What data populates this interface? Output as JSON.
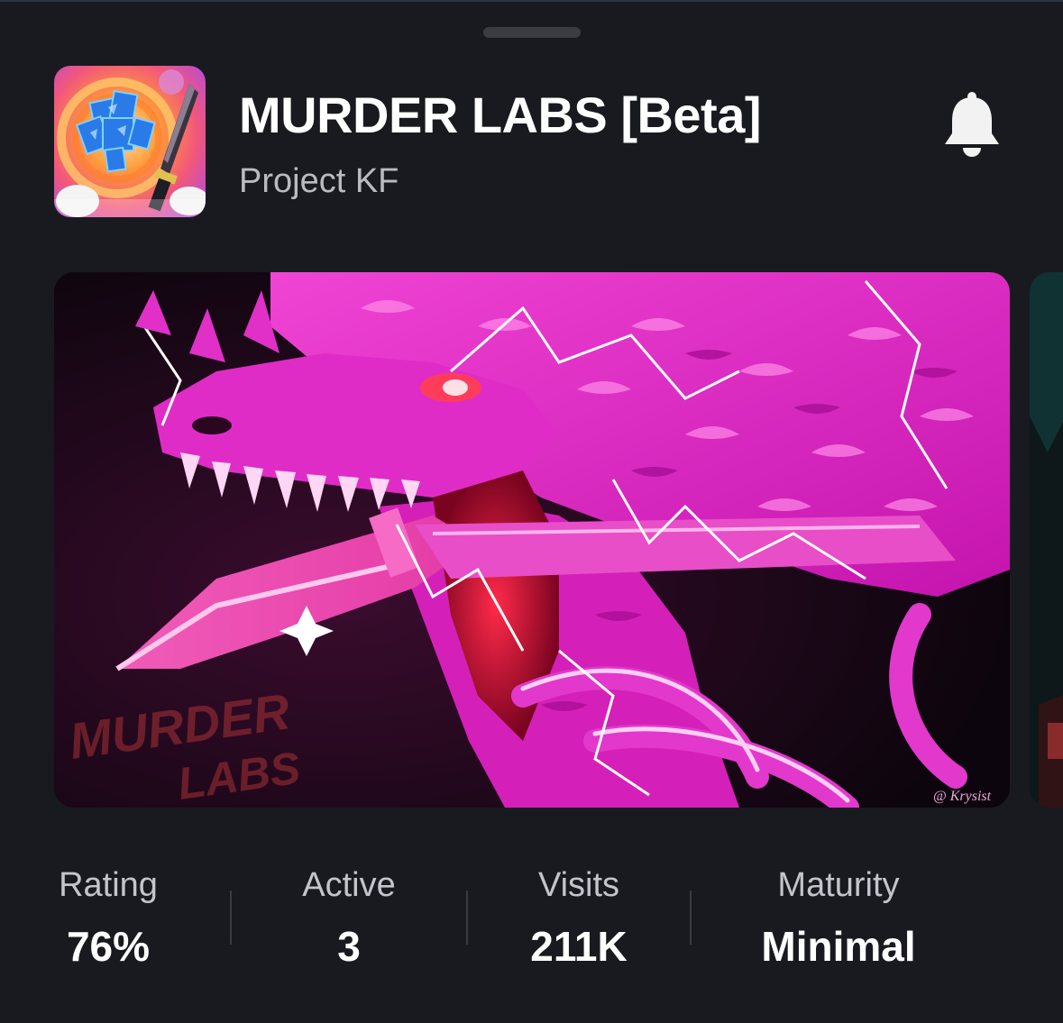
{
  "game": {
    "title": "MURDER LABS [Beta]",
    "creator": "Project KF",
    "icon": "game-thumbnail-icon",
    "notify_icon": "bell-icon"
  },
  "thumbnail": {
    "watermark_logo_line1": "MURDER",
    "watermark_logo_line2": "LABS",
    "artist_signature": "@ Krysist"
  },
  "stats": {
    "rating": {
      "label": "Rating",
      "value": "76%"
    },
    "active": {
      "label": "Active",
      "value": "3"
    },
    "visits": {
      "label": "Visits",
      "value": "211K"
    },
    "maturity": {
      "label": "Maturity",
      "value": "Minimal"
    }
  },
  "colors": {
    "background": "#191a1f",
    "text_primary": "#ffffff",
    "text_secondary": "#b9bbc2",
    "artwork_accent": "#e81cc8"
  }
}
